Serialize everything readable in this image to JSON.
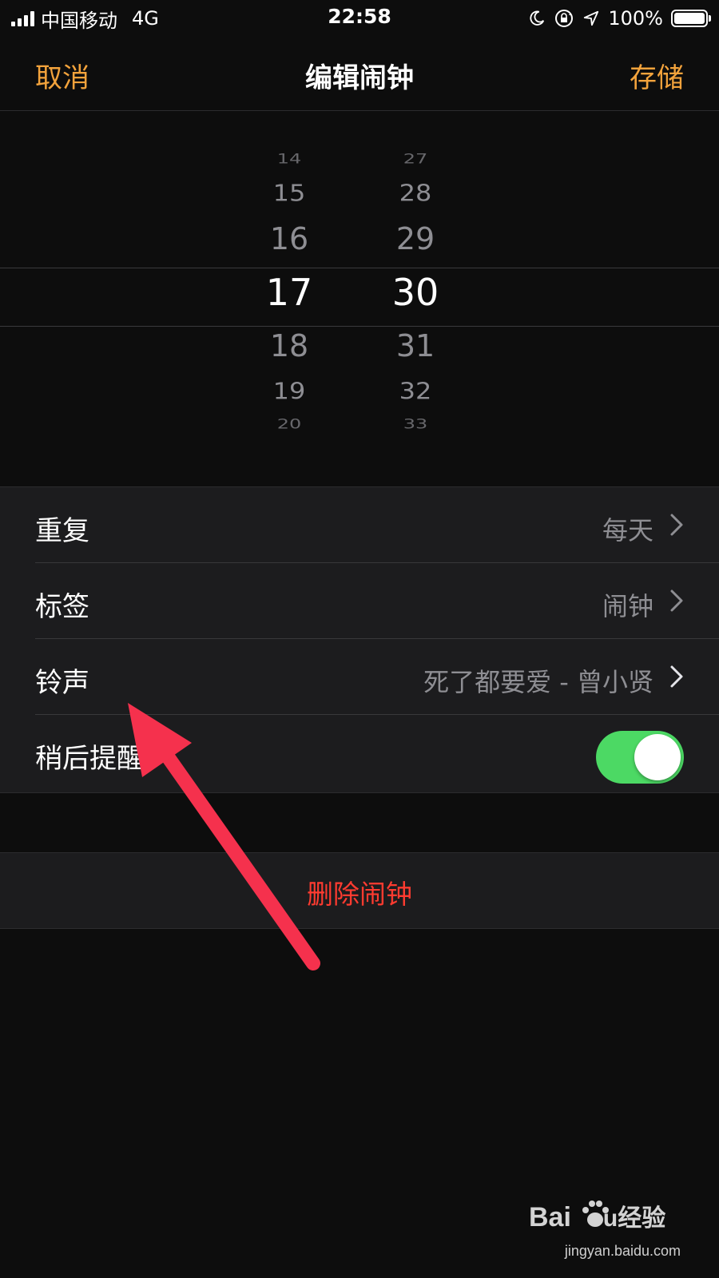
{
  "status_bar": {
    "carrier": "中国移动",
    "network": "4G",
    "time": "22:58",
    "battery_percent": "100%",
    "icons": [
      "signal-icon",
      "moon-icon",
      "orientation-lock-icon",
      "location-arrow-icon",
      "battery-icon"
    ]
  },
  "nav": {
    "cancel_label": "取消",
    "title": "编辑闹钟",
    "save_label": "存储",
    "accent_color": "#f3a33c"
  },
  "time_picker": {
    "hours": [
      "14",
      "15",
      "16",
      "17",
      "18",
      "19",
      "20"
    ],
    "minutes": [
      "27",
      "28",
      "29",
      "30",
      "31",
      "32",
      "33"
    ],
    "selected_hour": "17",
    "selected_minute": "30"
  },
  "settings": {
    "repeat": {
      "label": "重复",
      "value": "每天"
    },
    "label": {
      "label": "标签",
      "value": "闹钟"
    },
    "sound": {
      "label": "铃声",
      "value": "死了都要爱 - 曾小贤"
    },
    "snooze": {
      "label": "稍后提醒",
      "enabled": true,
      "toggle_color": "#4cd964"
    }
  },
  "delete": {
    "label": "删除闹钟",
    "color": "#ff3b30"
  },
  "annotation": {
    "arrow_color": "#f5314d"
  },
  "watermark": {
    "brand": "Baidu经验",
    "site": "jingyan.baidu.com"
  }
}
